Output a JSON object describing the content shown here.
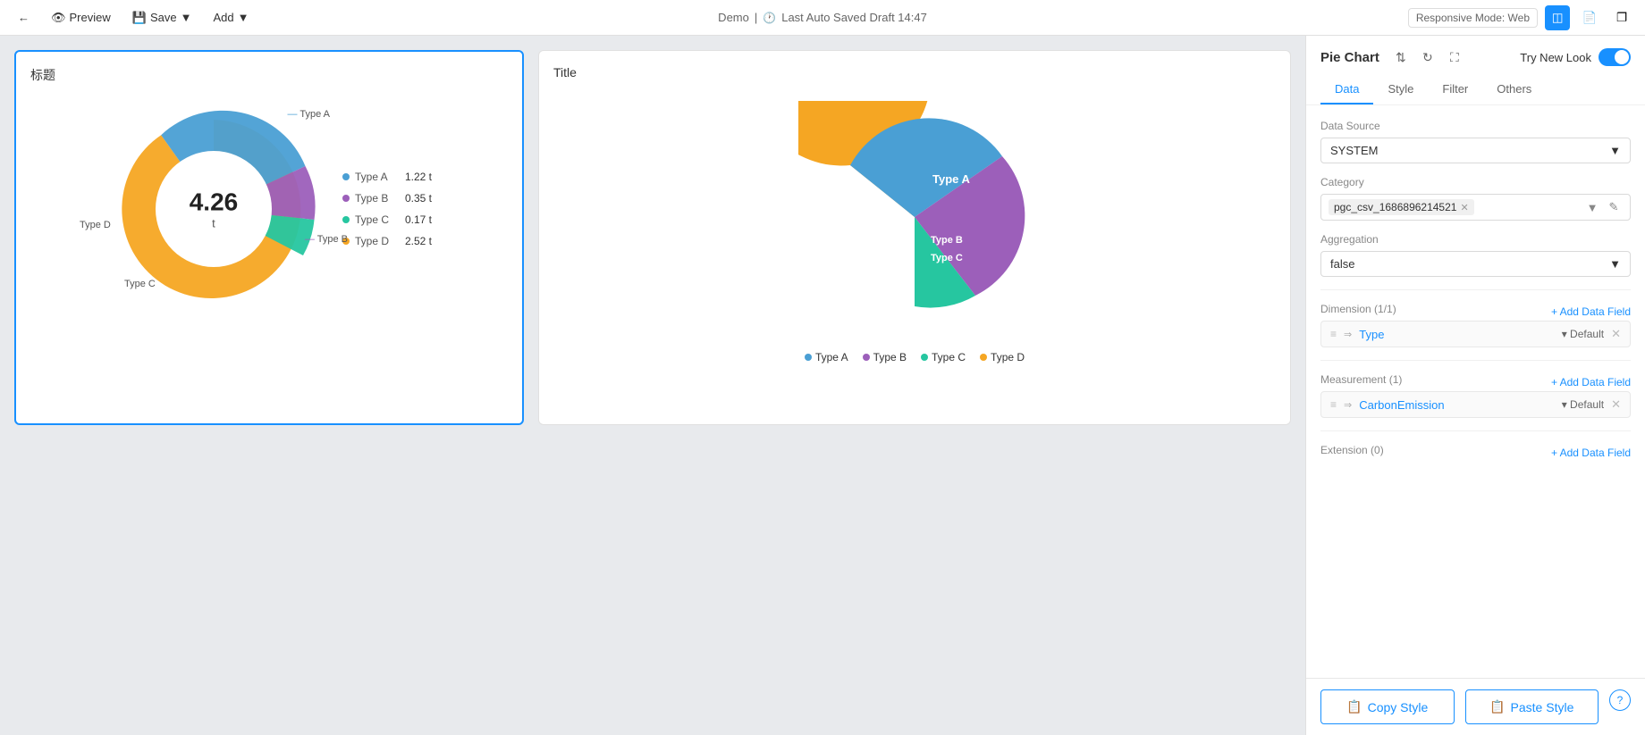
{
  "topbar": {
    "back_label": "←",
    "preview_label": "Preview",
    "save_label": "Save",
    "save_icon": "▾",
    "add_label": "Add",
    "add_icon": "▾",
    "app_name": "Demo",
    "separator": "|",
    "autosave_label": "Last Auto Saved Draft 14:47",
    "responsive_label": "Responsive Mode: Web",
    "mode_icon": "⊞"
  },
  "canvas": {
    "left_chart": {
      "title": "标题",
      "center_value": "4.26",
      "center_unit": "t",
      "segments": [
        {
          "label": "Type A",
          "value": 1.22,
          "unit": "t",
          "color": "#4a9fd4",
          "percent": 28.7
        },
        {
          "label": "Type B",
          "value": 0.35,
          "unit": "t",
          "color": "#9c5fba",
          "percent": 8.2
        },
        {
          "label": "Type C",
          "value": 0.17,
          "unit": "t",
          "color": "#00bcd4",
          "percent": 4.0
        },
        {
          "label": "Type D",
          "value": 2.52,
          "unit": "t",
          "color": "#f5a623",
          "percent": 59.1
        }
      ],
      "type_a_label": "Type A",
      "type_d_label": "Type D",
      "type_b_label": "Type B",
      "type_c_label": "Type C"
    },
    "right_chart": {
      "title": "Title",
      "segments": [
        {
          "label": "Type A",
          "color": "#4a9fd4",
          "percent": 35
        },
        {
          "label": "Type B",
          "color": "#9c5fba",
          "percent": 13
        },
        {
          "label": "Type C",
          "color": "#26c6a0",
          "percent": 8
        },
        {
          "label": "Type D",
          "color": "#f5a623",
          "percent": 44
        }
      ],
      "legend": [
        {
          "label": "Type A",
          "color": "#4a9fd4"
        },
        {
          "label": "Type B",
          "color": "#9c5fba"
        },
        {
          "label": "Type C",
          "color": "#26c6a0"
        },
        {
          "label": "Type D",
          "color": "#f5a623"
        }
      ]
    }
  },
  "panel": {
    "title": "Pie Chart",
    "try_new_look": "Try New Look",
    "tabs": [
      "Data",
      "Style",
      "Filter",
      "Others"
    ],
    "active_tab": "Data",
    "data_source_label": "Data Source",
    "data_source_value": "SYSTEM",
    "category_label": "Category",
    "category_tag": "pgc_csv_1686896214521",
    "aggregation_label": "Aggregation",
    "aggregation_value": "false",
    "dimension_label": "Dimension (1/1)",
    "add_data_field_label": "+ Add Data Field",
    "dimension_field": "Type",
    "dimension_default": "▾ Default",
    "measurement_label": "Measurement (1)",
    "measurement_add": "+ Add Data Field",
    "measurement_field": "CarbonEmission",
    "measurement_default": "▾ Default",
    "extension_label": "Extension (0)",
    "extension_add": "+ Add Data Field",
    "copy_style_label": "Copy Style",
    "paste_style_label": "Paste Style"
  }
}
